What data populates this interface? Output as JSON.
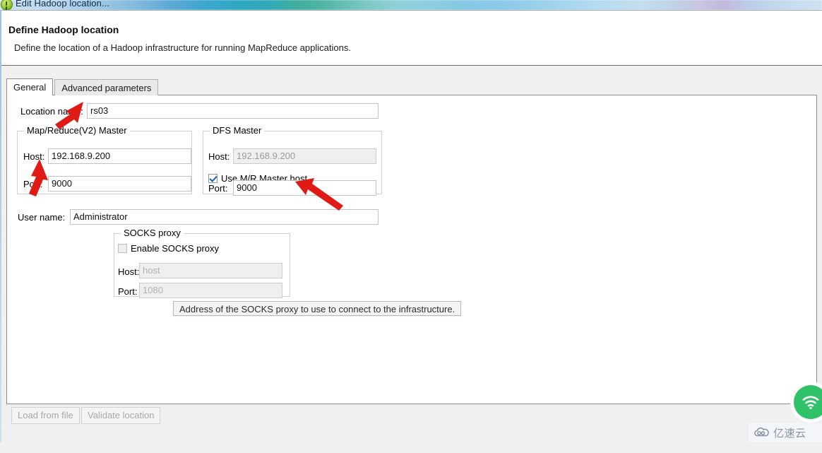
{
  "window": {
    "title": "Edit Hadoop location...",
    "icon": "hadoop-elephant-icon"
  },
  "header": {
    "title": "Define Hadoop location",
    "description": "Define the location of a Hadoop infrastructure for running MapReduce applications."
  },
  "tabs": [
    {
      "label": "General",
      "active": true
    },
    {
      "label": "Advanced parameters",
      "active": false
    }
  ],
  "form": {
    "location_name": {
      "label": "Location name:",
      "value": "rs03"
    },
    "mapreduce_master": {
      "group_title": "Map/Reduce(V2) Master",
      "host_label": "Host:",
      "host_value": "192.168.9.200",
      "port_label": "Port:",
      "port_value": "9000"
    },
    "dfs_master": {
      "group_title": "DFS Master",
      "use_mr_master_host_label": "Use M/R Master host",
      "use_mr_master_host_checked": true,
      "host_label": "Host:",
      "host_value": "192.168.9.200",
      "host_disabled": true,
      "port_label": "Port:",
      "port_value": "9000"
    },
    "user_name": {
      "label": "User name:",
      "value": "Administrator"
    },
    "socks_proxy": {
      "group_title": "SOCKS proxy",
      "enable_label": "Enable SOCKS proxy",
      "enable_checked": false,
      "host_label": "Host:",
      "host_placeholder": "host",
      "port_label": "Port:",
      "port_placeholder": "1080"
    }
  },
  "tooltip": {
    "text": "Address of the SOCKS proxy to use to connect to the infrastructure."
  },
  "footer": {
    "load_from_file_label": "Load from file",
    "validate_location_label": "Validate location"
  },
  "overlay": {
    "watermark_text": "亿速云",
    "arrow_color": "#e01b16",
    "badge_color": "#2fc268"
  }
}
